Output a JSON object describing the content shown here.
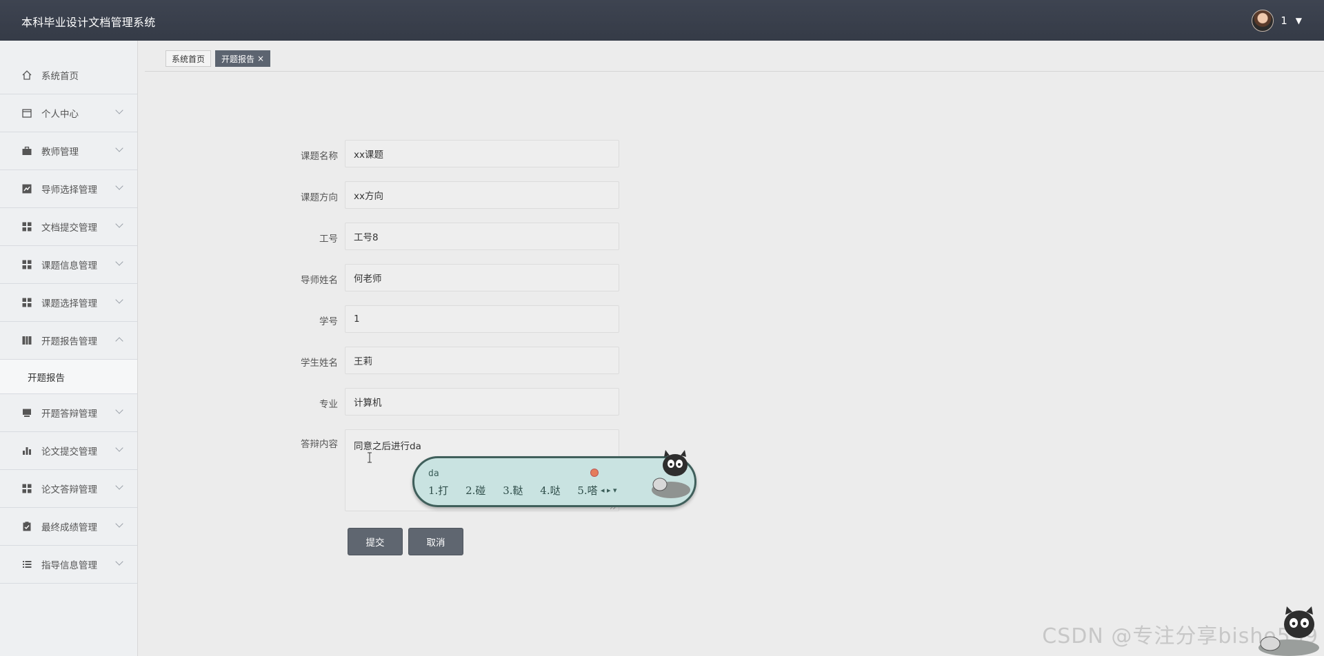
{
  "app": {
    "title": "本科毕业设计文档管理系统"
  },
  "user": {
    "name": "1"
  },
  "sidebar": {
    "items": [
      {
        "label": "系统首页",
        "icon": "home-icon"
      },
      {
        "label": "个人中心",
        "icon": "calendar-icon"
      },
      {
        "label": "教师管理",
        "icon": "briefcase-icon"
      },
      {
        "label": "导师选择管理",
        "icon": "chart-icon"
      },
      {
        "label": "文档提交管理",
        "icon": "grid-icon"
      },
      {
        "label": "课题信息管理",
        "icon": "grid-icon"
      },
      {
        "label": "课题选择管理",
        "icon": "grid-icon"
      },
      {
        "label": "开题报告管理",
        "icon": "book-icon",
        "expanded": true
      },
      {
        "label": "开题答辩管理",
        "icon": "monitor-icon"
      },
      {
        "label": "论文提交管理",
        "icon": "bar-chart-icon"
      },
      {
        "label": "论文答辩管理",
        "icon": "grid-icon"
      },
      {
        "label": "最终成绩管理",
        "icon": "clipboard-icon"
      },
      {
        "label": "指导信息管理",
        "icon": "list-icon"
      }
    ],
    "submenu": {
      "label": "开题报告"
    }
  },
  "tabs": [
    {
      "label": "系统首页"
    },
    {
      "label": "开题报告",
      "close": "×"
    }
  ],
  "form": {
    "fields": [
      {
        "label": "课题名称",
        "value": "xx课题"
      },
      {
        "label": "课题方向",
        "value": "xx方向"
      },
      {
        "label": "工号",
        "value": "工号8"
      },
      {
        "label": "导师姓名",
        "value": "何老师"
      },
      {
        "label": "学号",
        "value": "1"
      },
      {
        "label": "学生姓名",
        "value": "王莉"
      },
      {
        "label": "专业",
        "value": "计算机"
      }
    ],
    "textarea": {
      "label": "答辩内容",
      "value": "同意之后进行da"
    },
    "submit_label": "提交",
    "cancel_label": "取消"
  },
  "ime": {
    "pinyin": "da",
    "candidates": [
      "1.打",
      "2.碰",
      "3.鞑",
      "4.哒",
      "5.嗒"
    ]
  },
  "watermark": "CSDN @专注分享bisho539",
  "colors": {
    "topbar": "#3a404c",
    "accent_button": "#5f6670",
    "ime_bg": "#c9e3e1"
  }
}
